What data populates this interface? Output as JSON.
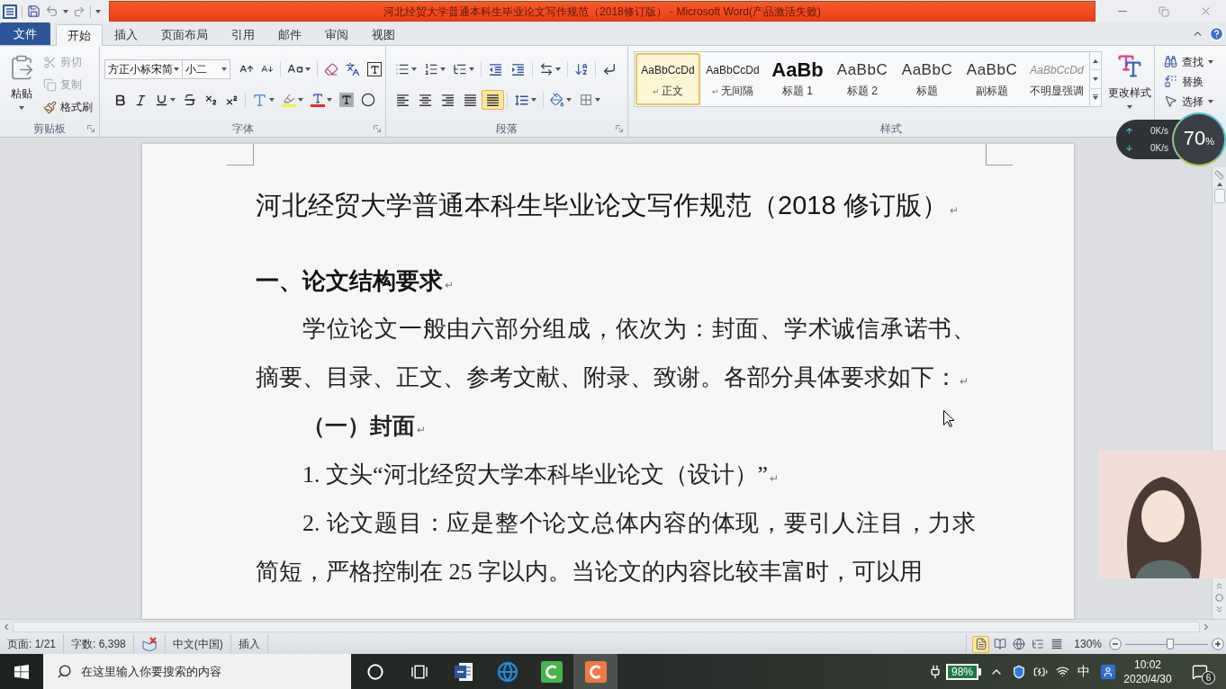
{
  "window": {
    "title": "河北经贸大学普通本科生毕业论文写作规范（2018修订版） - Microsoft Word(产品激活失败)"
  },
  "tabs": [
    {
      "label": "文件",
      "kind": "file",
      "selected": false
    },
    {
      "label": "开始",
      "kind": "tab",
      "selected": true
    },
    {
      "label": "插入",
      "kind": "tab",
      "selected": false
    },
    {
      "label": "页面布局",
      "kind": "tab",
      "selected": false
    },
    {
      "label": "引用",
      "kind": "tab",
      "selected": false
    },
    {
      "label": "邮件",
      "kind": "tab",
      "selected": false
    },
    {
      "label": "审阅",
      "kind": "tab",
      "selected": false
    },
    {
      "label": "视图",
      "kind": "tab",
      "selected": false
    }
  ],
  "clipboard": {
    "label": "剪贴板",
    "paste": "粘贴",
    "items": [
      {
        "kind": "cut",
        "label": "剪切",
        "disabled": true
      },
      {
        "kind": "copy",
        "label": "复制",
        "disabled": true
      },
      {
        "kind": "format_painter",
        "label": "格式刷",
        "disabled": false
      }
    ]
  },
  "font": {
    "label": "字体",
    "font_name": "方正小标宋简",
    "font_size": "小二"
  },
  "paragraph": {
    "label": "段落",
    "alignment": [
      {
        "kind": "left",
        "selected": false
      },
      {
        "kind": "center",
        "selected": false
      },
      {
        "kind": "right",
        "selected": false
      },
      {
        "kind": "justify",
        "selected": false
      },
      {
        "kind": "distributed",
        "selected": true
      }
    ]
  },
  "styles": {
    "label": "样式",
    "items": [
      {
        "kind": "plain",
        "sample": "AaBbCcDd",
        "mark": "↵",
        "label": "正文",
        "selected": true
      },
      {
        "kind": "plain",
        "sample": "AaBbCcDd",
        "mark": "↵",
        "label": "无间隔",
        "selected": false
      },
      {
        "kind": "strong",
        "sample": "AaBb",
        "label": "标题 1",
        "selected": false
      },
      {
        "kind": "large",
        "sample": "AaBbC",
        "label": "标题 2",
        "selected": false
      },
      {
        "kind": "large",
        "sample": "AaBbC",
        "label": "标题",
        "selected": false
      },
      {
        "kind": "large",
        "sample": "AaBbC",
        "label": "副标题",
        "selected": false
      },
      {
        "kind": "subtle",
        "sample": "AaBbCcDd",
        "label": "不明显强调",
        "selected": false
      }
    ],
    "change_styles": "更改样式"
  },
  "editing": [
    {
      "kind": "find",
      "label": "查找",
      "dropdown": true
    },
    {
      "kind": "replace",
      "label": "替换",
      "dropdown": false
    },
    {
      "kind": "select",
      "label": "选择",
      "dropdown": true
    }
  ],
  "document": {
    "paragraphs": [
      {
        "kind": "title",
        "text": "河北经贸大学普通本科生毕业论文写作规范（2018 修订版）",
        "mark": "↵"
      },
      {
        "kind": "heading",
        "text": "一、论文结构要求",
        "mark": "↵"
      },
      {
        "kind": "body",
        "text": "学位论文一般由六部分组成，依次为：封面、学术诚信承诺书、摘要、目录、正文、参考文献、附录、致谢。各部分具体要求如下：",
        "mark": "↵"
      },
      {
        "kind": "subheading",
        "text": "（一）封面",
        "mark": "↵"
      },
      {
        "kind": "item",
        "text": "1. 文头“河北经贸大学本科毕业论文（设计）”",
        "mark": "↵"
      },
      {
        "kind": "body",
        "text": "2. 论文题目：应是整个论文总体内容的体现，要引人注目，力求简短，严格控制在 25 字以内。当论文的内容比较丰富时，可以用"
      }
    ]
  },
  "status_bar": {
    "items": [
      {
        "kind": "text",
        "text": "页面: 1/21"
      },
      {
        "kind": "text",
        "text": "字数: 6,398"
      },
      {
        "kind": "proofing"
      },
      {
        "kind": "text",
        "text": "中文(中国)"
      },
      {
        "kind": "text",
        "text": "插入"
      }
    ],
    "views": [
      {
        "kind": "print",
        "selected": true
      },
      {
        "kind": "reading",
        "selected": false
      },
      {
        "kind": "web",
        "selected": false
      },
      {
        "kind": "outline",
        "selected": false
      },
      {
        "kind": "draft",
        "selected": false
      }
    ],
    "zoom": {
      "reading": "130%",
      "level": 0.54
    }
  },
  "net_monitor": {
    "upload": "0K/s",
    "download": "0K/s",
    "value": "70",
    "unit": "%"
  },
  "taskbar": {
    "search": {
      "placeholder": "在这里输入你要搜索的内容"
    },
    "apps": [
      {
        "kind": "cortana",
        "selected": false
      },
      {
        "kind": "task_view",
        "selected": false
      },
      {
        "kind": "word",
        "selected": false
      },
      {
        "kind": "ie",
        "selected": false
      },
      {
        "kind": "green_app",
        "selected": false
      },
      {
        "kind": "orange_app",
        "selected": true
      }
    ],
    "battery": "98%",
    "ime": "中",
    "time": "10:02",
    "date": "2020/4/30",
    "notifications": "6"
  }
}
